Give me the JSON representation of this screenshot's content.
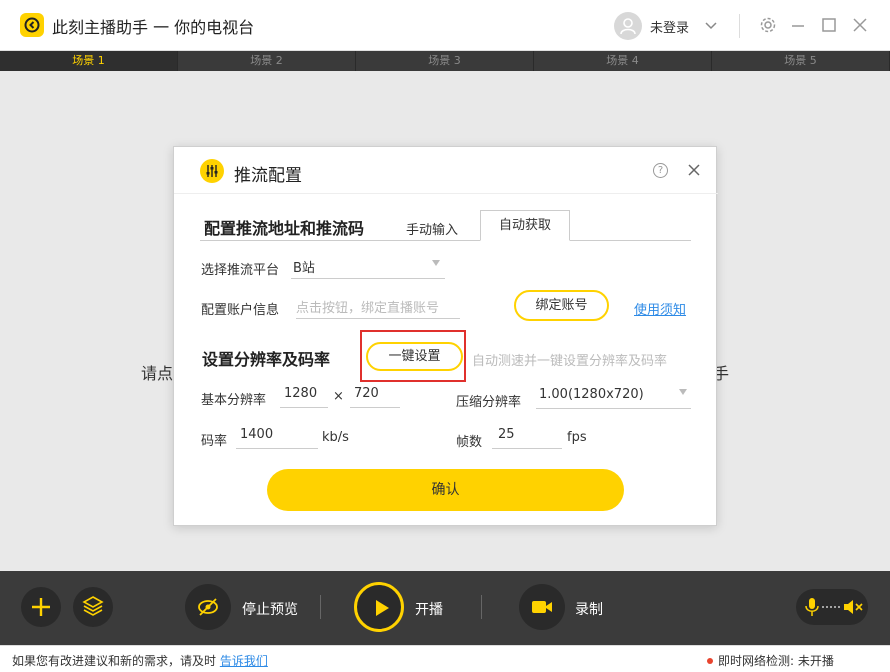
{
  "app": {
    "title": "此刻主播助手 一 你的电视台",
    "login_status": "未登录"
  },
  "scenes": [
    "场景 1",
    "场景 2",
    "场景 3",
    "场景 4",
    "场景 5"
  ],
  "active_scene": 0,
  "stage": {
    "text_left": "请点",
    "text_right": "手"
  },
  "dialog": {
    "title": "推流配置",
    "help": "?",
    "section1_title": "配置推流地址和推流码",
    "tab_manual": "手动输入",
    "tab_auto": "自动获取",
    "platform_label": "选择推流平台",
    "platform_value": "B站",
    "account_label": "配置账户信息",
    "account_placeholder": "点击按钮，绑定直播账号",
    "bind_button": "绑定账号",
    "usage_link": "使用须知",
    "section2_title": "设置分辨率及码率",
    "oneclick_button": "一键设置",
    "oneclick_hint": "自动测速并一键设置分辨率及码率",
    "base_res_label": "基本分辨率",
    "base_width": "1280",
    "times": "×",
    "base_height": "720",
    "compress_label": "压缩分辨率",
    "compress_value": "1.00(1280x720)",
    "bitrate_label": "码率",
    "bitrate_value": "1400",
    "bitrate_unit": "kb/s",
    "fps_label": "帧数",
    "fps_value": "25",
    "fps_unit": "fps",
    "confirm_button": "确认"
  },
  "controls": {
    "stop_preview": "停止预览",
    "start_live": "开播",
    "record": "录制"
  },
  "status": {
    "feedback_text": "如果您有改进建议和新的需求，请及时",
    "feedback_link": "告诉我们",
    "network_text": "即时网络检测:  未开播"
  },
  "colors": {
    "accent": "#ffd200",
    "link": "#2d8ae6",
    "highlight_box": "#e0302c"
  }
}
